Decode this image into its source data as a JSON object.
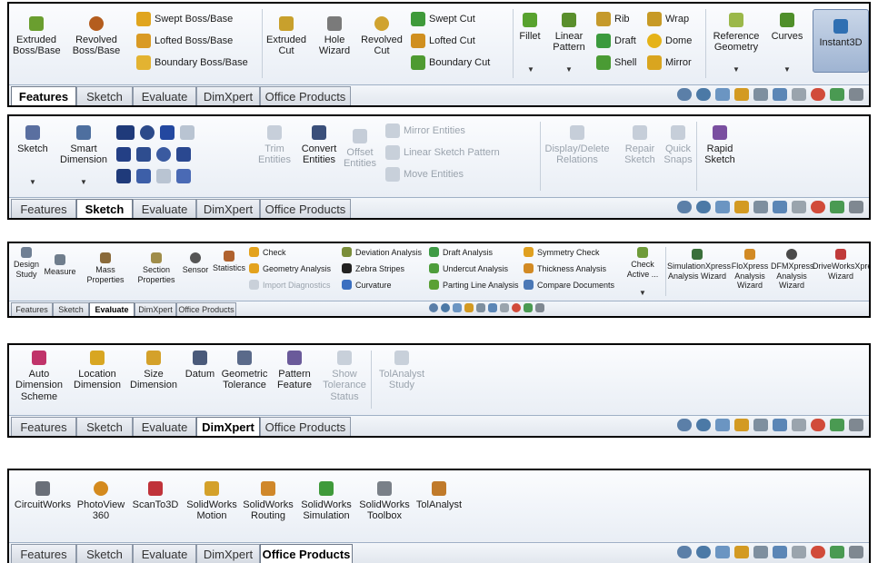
{
  "tabs": [
    "Features",
    "Sketch",
    "Evaluate",
    "DimXpert",
    "Office Products"
  ],
  "features": {
    "large": [
      "Extruded\nBoss/Base",
      "Revolved\nBoss/Base",
      "Extruded\nCut",
      "Hole\nWizard",
      "Revolved\nCut",
      "Fillet",
      "Linear\nPattern",
      "Reference\nGeometry",
      "Curves",
      "Instant3D"
    ],
    "boss_list": [
      "Swept Boss/Base",
      "Lofted Boss/Base",
      "Boundary Boss/Base"
    ],
    "cut_list": [
      "Swept Cut",
      "Lofted Cut",
      "Boundary Cut"
    ],
    "misc1": [
      "Rib",
      "Draft",
      "Shell"
    ],
    "misc2": [
      "Wrap",
      "Dome",
      "Mirror"
    ]
  },
  "sketch": {
    "sketch": "Sketch",
    "smart_dim": "Smart\nDimension",
    "trim": "Trim\nEntities",
    "convert": "Convert\nEntities",
    "offset": "Offset\nEntities",
    "mirror": "Mirror Entities",
    "linear": "Linear Sketch Pattern",
    "move": "Move Entities",
    "display": "Display/Delete\nRelations",
    "repair": "Repair\nSketch",
    "quick": "Quick\nSnaps",
    "rapid": "Rapid\nSketch"
  },
  "evaluate": {
    "design": "Design\nStudy",
    "measure": "Measure",
    "mass": "Mass\nProperties",
    "section": "Section\nProperties",
    "sensor": "Sensor",
    "statistics": "Statistics",
    "col1": [
      "Check",
      "Geometry Analysis",
      "Import Diagnostics"
    ],
    "col2": [
      "Deviation Analysis",
      "Zebra Stripes",
      "Curvature"
    ],
    "col3": [
      "Draft Analysis",
      "Undercut Analysis",
      "Parting Line Analysis"
    ],
    "col4": [
      "Symmetry Check",
      "Thickness Analysis",
      "Compare Documents"
    ],
    "check_active": "Check\nActive ...",
    "xpress": [
      "SimulationXpress\nAnalysis Wizard",
      "FloXpress\nAnalysis\nWizard",
      "DFMXpress\nAnalysis\nWizard",
      "DriveWorksXpress\nWizard"
    ]
  },
  "dimxpert": {
    "auto": "Auto\nDimension\nScheme",
    "location": "Location\nDimension",
    "size": "Size\nDimension",
    "datum": "Datum",
    "geom": "Geometric\nTolerance",
    "pattern": "Pattern\nFeature",
    "show": "Show\nTolerance\nStatus",
    "tol": "TolAnalyst\nStudy"
  },
  "office": [
    "CircuitWorks",
    "PhotoView\n360",
    "ScanTo3D",
    "SolidWorks\nMotion",
    "SolidWorks\nRouting",
    "SolidWorks\nSimulation",
    "SolidWorks\nToolbox",
    "TolAnalyst"
  ]
}
